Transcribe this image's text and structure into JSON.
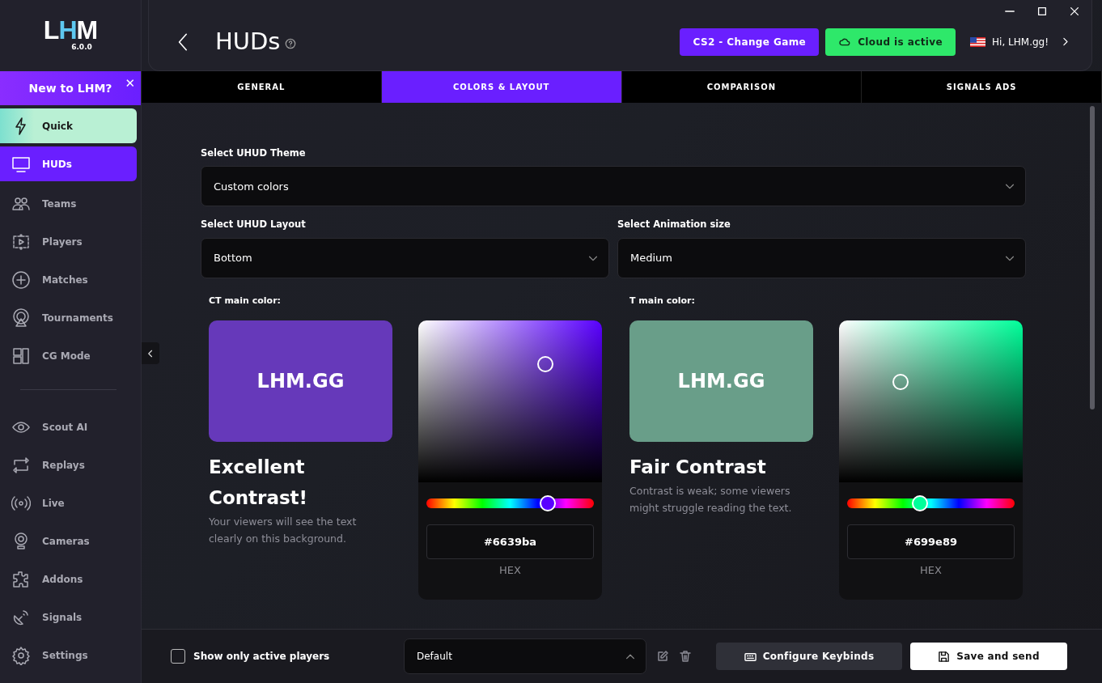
{
  "app": {
    "logo": [
      {
        "text": "L",
        "color": "#ffffff"
      },
      {
        "text": "H",
        "color": "#5ec8f0"
      },
      {
        "text": "M",
        "color": "#ffffff"
      }
    ],
    "version": "6.0.0"
  },
  "banner": {
    "text": "New to LHM?",
    "close": "✕"
  },
  "sidebar": {
    "groups": [
      [
        {
          "label": "Quick",
          "kind": "featured",
          "selected": false
        },
        {
          "label": "HUDs",
          "kind": "link",
          "selected": true
        },
        {
          "label": "Teams",
          "kind": "link",
          "selected": false
        },
        {
          "label": "Players",
          "kind": "link",
          "selected": false
        },
        {
          "label": "Matches",
          "kind": "link",
          "selected": false
        },
        {
          "label": "Tournaments",
          "kind": "link",
          "selected": false
        },
        {
          "label": "CG Mode",
          "kind": "link",
          "selected": false
        }
      ],
      [
        {
          "label": "Scout AI",
          "kind": "link",
          "selected": false
        },
        {
          "label": "Replays",
          "kind": "link",
          "selected": false
        },
        {
          "label": "Live",
          "kind": "link",
          "selected": false
        },
        {
          "label": "Cameras",
          "kind": "link",
          "selected": false
        },
        {
          "label": "Addons",
          "kind": "link",
          "selected": false
        },
        {
          "label": "Signals",
          "kind": "link",
          "selected": false
        },
        {
          "label": "Settings",
          "kind": "link",
          "selected": false
        }
      ]
    ]
  },
  "header": {
    "title": "HUDs",
    "buttons": [
      {
        "label": "CS2 - Change Game",
        "kind": "game"
      },
      {
        "label": "Cloud is active",
        "kind": "cloud"
      }
    ],
    "user": "Hi, LHM.gg!"
  },
  "tabs": [
    {
      "label": "GENERAL",
      "selected": false
    },
    {
      "label": "COLORS & LAYOUT",
      "selected": true
    },
    {
      "label": "COMPARISON",
      "selected": false
    },
    {
      "label": "SIGNALS ADS",
      "selected": false
    }
  ],
  "form": {
    "theme": {
      "label": "Select UHUD Theme",
      "value": "Custom colors"
    },
    "layout": {
      "label": "Select UHUD Layout",
      "value": "Bottom"
    },
    "animation": {
      "label": "Select Animation size",
      "value": "Medium"
    }
  },
  "colors": [
    {
      "label": "CT main color:",
      "color": "#6639ba",
      "level": 0.725,
      "preview": "LHM.GG",
      "rating": "Excellent Contrast!",
      "description": "Your viewers will see the text clearly on this background.",
      "hex": "#6639ba",
      "hex_label": "HEX"
    },
    {
      "label": "T main color:",
      "color": "#699e89",
      "level": 0.434,
      "preview": "LHM.GG",
      "rating": "Fair Contrast",
      "description": "Contrast is weak; some viewers might struggle reading the text.",
      "hex": "#699e89",
      "hex_label": "HEX"
    }
  ],
  "footer": {
    "checkbox": {
      "label": "Show only active players",
      "checked": false
    },
    "preset": "Default",
    "buttons": [
      {
        "label": "Configure Keybinds",
        "kind": "secondary"
      },
      {
        "label": "Save and send",
        "kind": "primary"
      }
    ]
  }
}
